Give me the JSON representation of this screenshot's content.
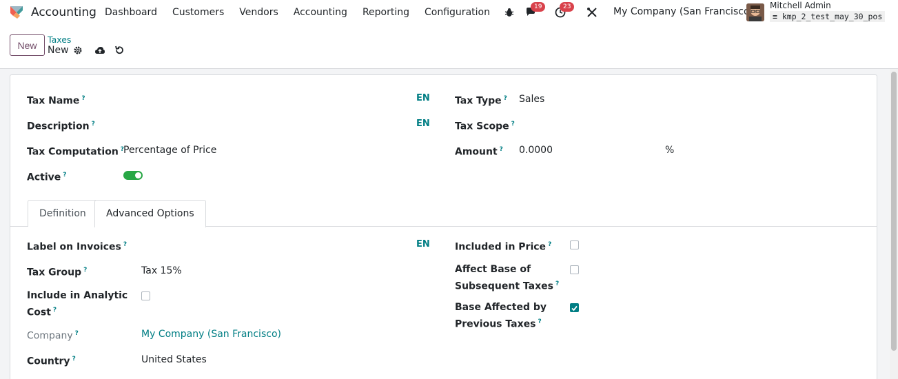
{
  "navbar": {
    "app_name": "Accounting",
    "menu": [
      "Dashboard",
      "Customers",
      "Vendors",
      "Accounting",
      "Reporting",
      "Configuration"
    ],
    "tray": {
      "bug_icon": "bug-icon",
      "chat_badge": "19",
      "activity_badge": "23"
    },
    "company": "My Company (San Francisco)",
    "user_name": "Mitchell Admin",
    "db_name": "kmp_2_test_may_30_pos"
  },
  "control": {
    "new_label": "New",
    "breadcrumb_parent": "Taxes",
    "breadcrumb_current": "New"
  },
  "form": {
    "tax_name_label": "Tax Name",
    "description_label": "Description",
    "tax_computation_label": "Tax Computation",
    "tax_computation_value": "Percentage of Price",
    "active_label": "Active",
    "active_value": true,
    "tax_type_label": "Tax Type",
    "tax_type_value": "Sales",
    "tax_scope_label": "Tax Scope",
    "amount_label": "Amount",
    "amount_value": "0.0000",
    "amount_unit": "%",
    "lang": "EN",
    "help": "?"
  },
  "tabs": [
    {
      "label": "Definition",
      "active": false
    },
    {
      "label": "Advanced Options",
      "active": true
    }
  ],
  "advanced": {
    "label_invoices_label": "Label on Invoices",
    "tax_group_label": "Tax Group",
    "tax_group_value": "Tax 15%",
    "include_analytic_line1": "Include in Analytic",
    "include_analytic_line2": "Cost",
    "include_analytic_value": false,
    "company_label": "Company",
    "company_value": "My Company (San Francisco)",
    "country_label": "Country",
    "country_value": "United States",
    "included_price_label": "Included in Price",
    "included_price_value": false,
    "affect_base_line1": "Affect Base of",
    "affect_base_line2": "Subsequent Taxes",
    "affect_base_value": false,
    "base_affected_line1": "Base Affected by",
    "base_affected_line2": "Previous Taxes",
    "base_affected_value": true
  },
  "colors": {
    "accent": "#017e84",
    "brand": "#714b67",
    "toggle_on": "#28a745",
    "badge": "#d9424b"
  }
}
